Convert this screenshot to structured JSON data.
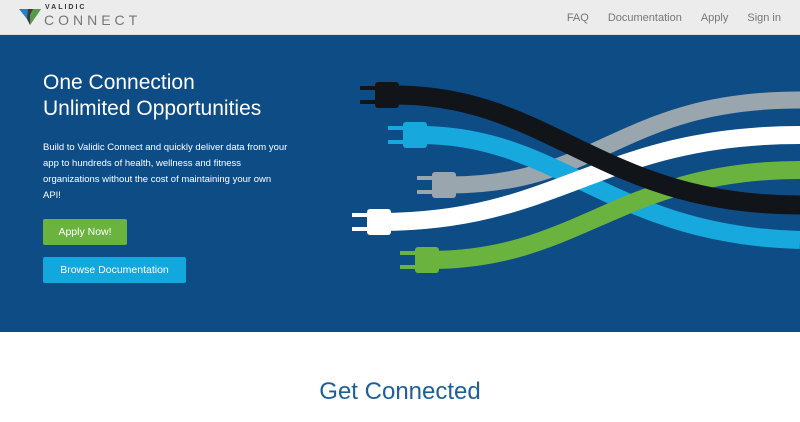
{
  "header": {
    "logo": {
      "small_text": "VALIDIC",
      "big_text": "CONNECT"
    },
    "nav": [
      {
        "label": "FAQ"
      },
      {
        "label": "Documentation"
      },
      {
        "label": "Apply"
      },
      {
        "label": "Sign in"
      }
    ]
  },
  "hero": {
    "title_line1": "One Connection",
    "title_line2": "Unlimited Opportunities",
    "description": "Build to Validic Connect and quickly deliver data from your app to hundreds of health, wellness and fitness organizations without the cost of maintaining your own API!",
    "apply_button": "Apply Now!",
    "docs_button": "Browse Documentation",
    "colors": {
      "background": "#0e4c86",
      "apply": "#6bb33f",
      "docs": "#13a8dd"
    }
  },
  "section": {
    "title": "Get Connected"
  }
}
